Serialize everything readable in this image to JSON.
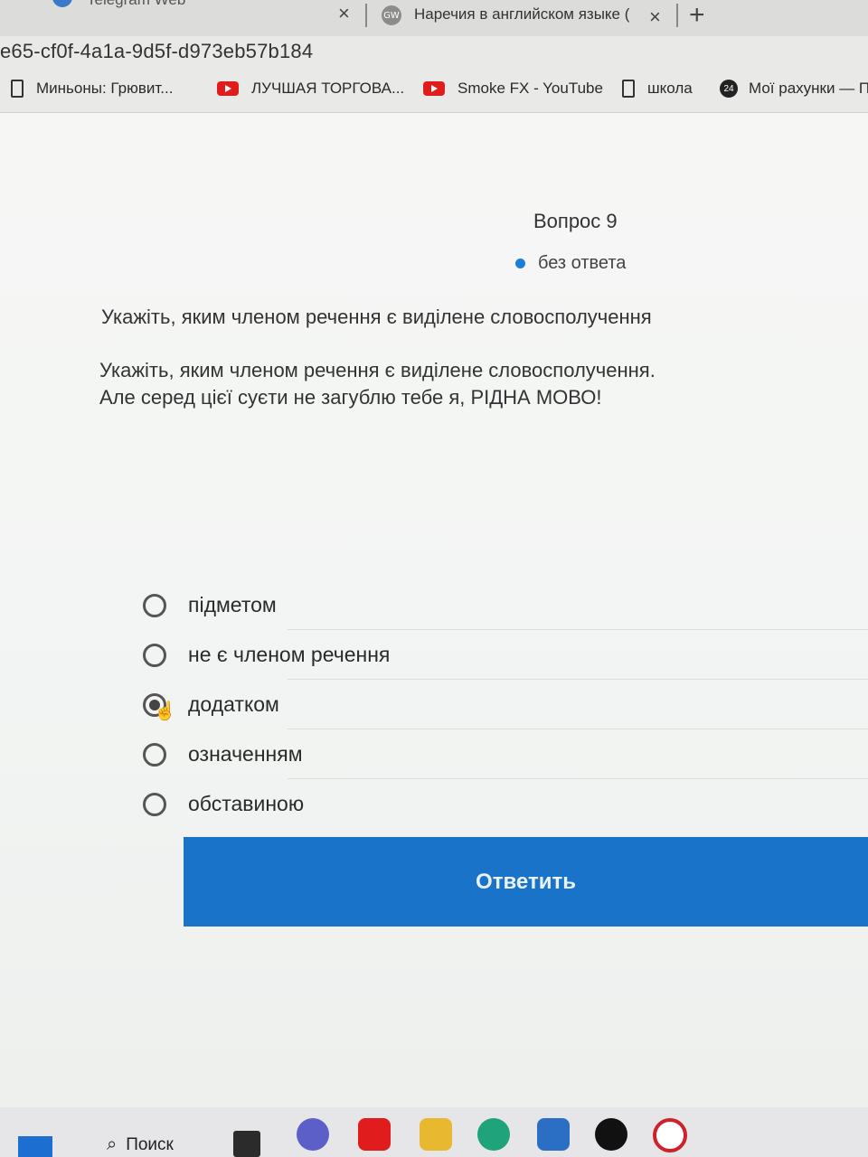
{
  "browser": {
    "tabs": [
      {
        "title": "Telegram Web",
        "close": "×"
      },
      {
        "favicon": "GW",
        "title": "Наречия в английском языке (",
        "close": "×"
      }
    ],
    "new_tab": "+",
    "url": "e65-cf0f-4a1a-9d5f-d973eb57b184",
    "bookmarks": [
      {
        "icon": "document-icon",
        "label": "Миньоны: Грювит..."
      },
      {
        "icon": "youtube-icon",
        "label": "ЛУЧШАЯ ТОРГОВА..."
      },
      {
        "icon": "youtube-icon",
        "label": "Smoke FX - YouTube"
      },
      {
        "icon": "document-icon",
        "label": "школа"
      },
      {
        "icon": "privat24-icon",
        "badge": "24",
        "label": "Мої рахунки — П"
      }
    ]
  },
  "quiz": {
    "question_number": "Вопрос 9",
    "status": "без ответа",
    "status_color": "#1a7fd6",
    "prompt": "Укажіть, яким членом речення є виділене словосполучення",
    "body_line1": "Укажіть, яким членом речення є виділене словосполучення.",
    "body_line2": "Але серед цієї суєти не загублю тебе я, РІДНА МОВО!",
    "options": [
      {
        "label": "підметом",
        "selected": false
      },
      {
        "label": "не є членом речення",
        "selected": false
      },
      {
        "label": "додатком",
        "selected": true
      },
      {
        "label": "означенням",
        "selected": false
      },
      {
        "label": "обставиною",
        "selected": false
      }
    ],
    "submit_label": "Ответить",
    "accent_color": "#1973c9"
  },
  "taskbar": {
    "search_label": "Поиск",
    "icons": [
      "windows-start-icon",
      "search-icon",
      "file-explorer-icon",
      "teams-icon",
      "youtube-icon",
      "folder-icon",
      "edge-icon",
      "mail-icon",
      "tiktok-icon",
      "opera-icon"
    ]
  }
}
